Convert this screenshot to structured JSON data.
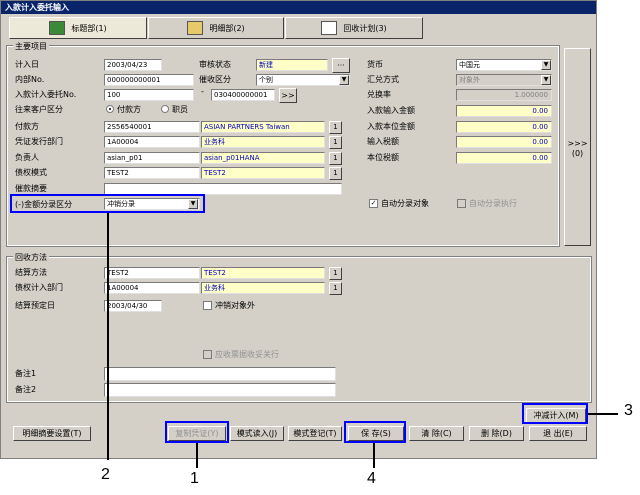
{
  "window": {
    "title": "入款计入委托输入"
  },
  "tabs": [
    {
      "label": "标题部(1)"
    },
    {
      "label": "明细部(2)"
    },
    {
      "label": "回收计划(3)"
    }
  ],
  "main_group": {
    "label": "主要项目",
    "entry_date_label": "计入日",
    "entry_date": "2003/04/23",
    "review_status_label": "审核状态",
    "review_status": "新建",
    "review_btn": "···",
    "internal_no_label": "内部No.",
    "internal_no": "000000000001",
    "payment_type_label": "催收区分",
    "payment_type": "个别",
    "commission_no_label": "入款计入委托No.",
    "commission_no": "100",
    "commission_no2": "030400000001",
    "commission_btn": ">>",
    "client_type_label": "往来客户区分",
    "radio_payer": "付款方",
    "radio_staff": "职员",
    "payer_label": "付款方",
    "payer_code": "2S56540001",
    "payer_name": "ASIAN PARTNERS Taiwan",
    "dept_label": "凭证发行部门",
    "dept_code": "1A00004",
    "dept_name": "业务科",
    "person_label": "负责人",
    "person_code": "asian_p01",
    "person_name": "asian_p01HANA",
    "mode_label": "债权模式",
    "mode_code": "TEST2",
    "mode_name": "TEST2",
    "summary_label": "催款摘要",
    "amount_type_label": "(-)金额分录区分",
    "amount_type": "冲销分录",
    "one_btn": "1",
    "currency_label": "货币",
    "currency": "中国元",
    "rate_method_label": "汇兑方式",
    "rate_method": "对象外",
    "rate_label": "兑换率",
    "rate": "1.000000",
    "input_amount_label": "入款输入金额",
    "input_amount": "0.00",
    "base_amount_label": "入款本位金额",
    "base_amount": "0.00",
    "input_tax_label": "输入税额",
    "input_tax": "0.00",
    "base_tax_label": "本位税额",
    "base_tax": "0.00",
    "auto_entry_label": "自动分录对象",
    "auto_exec_label": "自动分录执行",
    "expand_label": ">>>\n(0)"
  },
  "collect_group": {
    "label": "回收方法",
    "method_label": "结算方法",
    "method_code": "TEST2",
    "method_name": "TEST2",
    "dept_label": "债权计入部门",
    "dept_code": "1A00004",
    "dept_name": "业务科",
    "due_label": "结算预定日",
    "due_date": "2003/04/30",
    "offset_label": "冲销对象外",
    "receivable_label": "应收票据收妥关行",
    "note1_label": "备注1",
    "note2_label": "备注2"
  },
  "buttons": {
    "detail_setting": "明细摘要设置(T)",
    "copy_voucher": "复制凭证(Y)",
    "mode_read": "模式读入(J)",
    "mode_register": "模式登记(T)",
    "save": "保  存(S)",
    "clear": "清  除(C)",
    "delete": "删  除(D)",
    "exit": "退  出(E)",
    "offset_entry": "冲减计入(M)"
  },
  "callouts": [
    "1",
    "2",
    "3",
    "4"
  ],
  "colors": {
    "highlight": "#0000ff",
    "titlebar": "#0a246a",
    "yellow_field": "#ffffc8"
  }
}
